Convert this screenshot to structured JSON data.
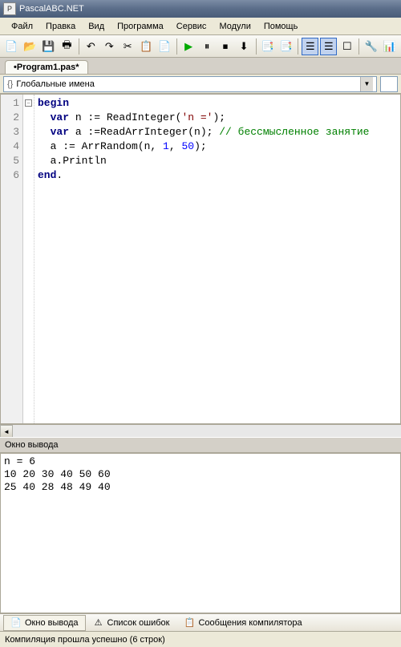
{
  "title": "PascalABC.NET",
  "menu": [
    "Файл",
    "Правка",
    "Вид",
    "Программа",
    "Сервис",
    "Модули",
    "Помощь"
  ],
  "tab": "•Program1.pas*",
  "scope_label": "Глобальные имена",
  "code": {
    "lines": [
      {
        "n": 1,
        "segs": [
          {
            "t": "begin",
            "c": "kw"
          }
        ]
      },
      {
        "n": 2,
        "segs": [
          {
            "t": "  ",
            "c": ""
          },
          {
            "t": "var",
            "c": "kw"
          },
          {
            "t": " n := ReadInteger(",
            "c": ""
          },
          {
            "t": "'n ='",
            "c": "str"
          },
          {
            "t": ");",
            "c": ""
          }
        ]
      },
      {
        "n": 3,
        "segs": [
          {
            "t": "  ",
            "c": ""
          },
          {
            "t": "var",
            "c": "kw"
          },
          {
            "t": " a :=ReadArrInteger(n); ",
            "c": ""
          },
          {
            "t": "// бессмысленное занятие",
            "c": "comment"
          }
        ]
      },
      {
        "n": 4,
        "segs": [
          {
            "t": "  a := ArrRandom(n, ",
            "c": ""
          },
          {
            "t": "1",
            "c": "num"
          },
          {
            "t": ", ",
            "c": ""
          },
          {
            "t": "50",
            "c": "num"
          },
          {
            "t": ");",
            "c": ""
          }
        ]
      },
      {
        "n": 5,
        "segs": [
          {
            "t": "  a.Println",
            "c": ""
          }
        ]
      },
      {
        "n": 6,
        "segs": [
          {
            "t": "end",
            "c": "kw"
          },
          {
            "t": ".",
            "c": ""
          }
        ]
      }
    ]
  },
  "output_title": "Окно вывода",
  "output": "n = 6\n10 20 30 40 50 60\n25 40 28 48 49 40",
  "bottom_tabs": [
    {
      "label": "Окно вывода",
      "icon": "📄",
      "active": true
    },
    {
      "label": "Список ошибок",
      "icon": "⚠",
      "active": false
    },
    {
      "label": "Сообщения компилятора",
      "icon": "📋",
      "active": false
    }
  ],
  "status": "Компиляция прошла успешно (6 строк)",
  "toolbar_icons": [
    "📄",
    "📂",
    "💾",
    "🖶",
    "|",
    "↶",
    "↷",
    "✂",
    "📋",
    "📄",
    "|",
    "▶",
    "⏸",
    "⏹",
    "⬇",
    "|",
    "📑",
    "📑",
    "|",
    "☰",
    "☰",
    "☐",
    "|",
    "🔧",
    "📊"
  ]
}
